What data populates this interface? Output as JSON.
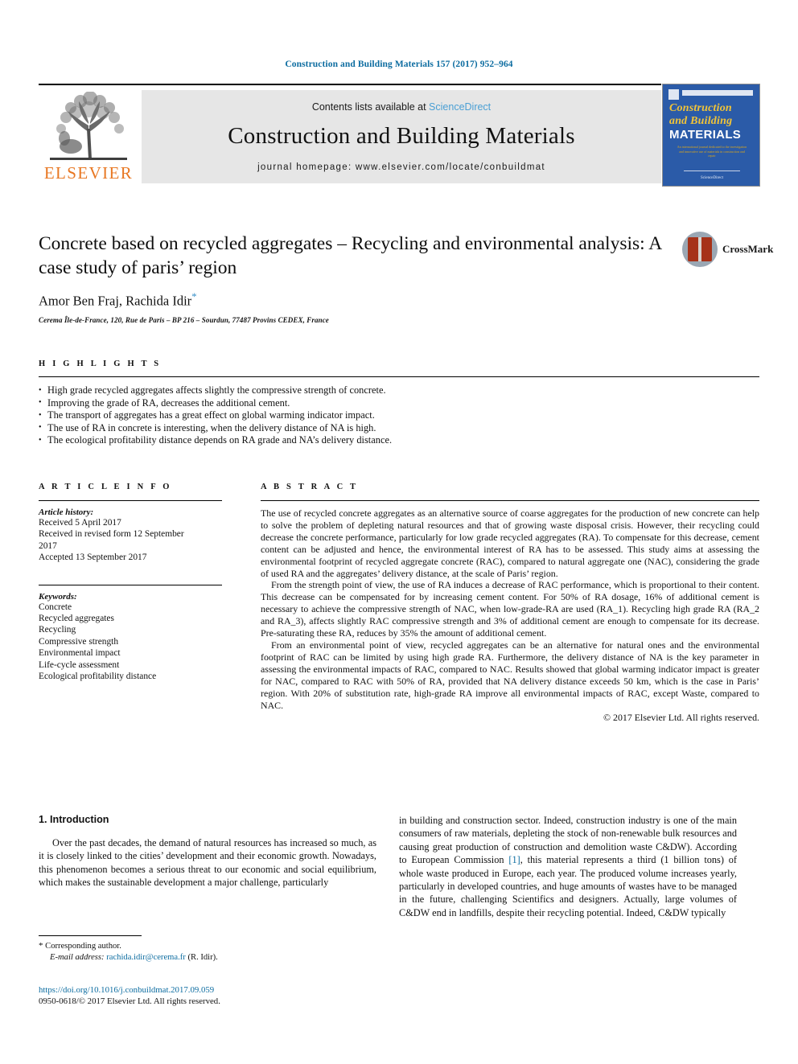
{
  "running_head": "Construction and Building Materials 157 (2017) 952–964",
  "masthead": {
    "contents_prefix": "Contents lists available at ",
    "sciencedirect": "ScienceDirect",
    "journal_title": "Construction and Building Materials",
    "homepage": "journal homepage: www.elsevier.com/locate/conbuildmat",
    "publisher_wordmark": "ELSEVIER"
  },
  "cover": {
    "line1": "Construction",
    "line2": "and Building",
    "line3": "MATERIALS",
    "blurb": "An international journal dedicated to the investigation and innovative use of materials in construction and repair",
    "foot": "ScienceDirect"
  },
  "crossmark": {
    "label": "CrossMark"
  },
  "article": {
    "title": "Concrete based on recycled aggregates – Recycling and environmental analysis: A case study of paris’ region",
    "authors": "Amor Ben Fraj, Rachida Idir",
    "corresponding_marker": "*",
    "affiliation": "Cerema Île-de-France, 120, Rue de Paris – BP 216 – Sourdun, 77487 Provins CEDEX, France"
  },
  "highlights": {
    "label": "H I G H L I G H T S",
    "items": [
      "High grade recycled aggregates affects slightly the compressive strength of concrete.",
      "Improving the grade of RA, decreases the additional cement.",
      "The transport of aggregates has a great effect on global warming indicator impact.",
      "The use of RA in concrete is interesting, when the delivery distance of NA is high.",
      "The ecological profitability distance depends on RA grade and NA’s delivery distance."
    ]
  },
  "article_info": {
    "label": "A R T I C L E   I N F O",
    "history_label": "Article history:",
    "history": [
      "Received 5 April 2017",
      "Received in revised form 12 September",
      "2017",
      "Accepted 13 September 2017"
    ],
    "keywords_label": "Keywords:",
    "keywords": [
      "Concrete",
      "Recycled aggregates",
      "Recycling",
      "Compressive strength",
      "Environmental impact",
      "Life-cycle assessment",
      "Ecological profitability distance"
    ]
  },
  "abstract": {
    "label": "A B S T R A C T",
    "paragraphs": [
      "The use of recycled concrete aggregates as an alternative source of coarse aggregates for the production of new concrete can help to solve the problem of depleting natural resources and that of growing waste disposal crisis. However, their recycling could decrease the concrete performance, particularly for low grade recycled aggregates (RA). To compensate for this decrease, cement content can be adjusted and hence, the environmental interest of RA has to be assessed. This study aims at assessing the environmental footprint of recycled aggregate concrete (RAC), compared to natural aggregate one (NAC), considering the grade of used RA and the aggregates’ delivery distance, at the scale of Paris’ region.",
      "From the strength point of view, the use of RA induces a decrease of RAC performance, which is proportional to their content. This decrease can be compensated for by increasing cement content. For 50% of RA dosage, 16% of additional cement is necessary to achieve the compressive strength of NAC, when low-grade-RA are used (RA_1). Recycling high grade RA (RA_2 and RA_3), affects slightly RAC compressive strength and 3% of additional cement are enough to compensate for its decrease. Pre-saturating these RA, reduces by 35% the amount of additional cement.",
      "From an environmental point of view, recycled aggregates can be an alternative for natural ones and the environmental footprint of RAC can be limited by using high grade RA. Furthermore, the delivery distance of NA is the key parameter in assessing the environmental impacts of RAC, compared to NAC. Results showed that global warming indicator impact is greater for NAC, compared to RAC with 50% of RA, provided that NA delivery distance exceeds 50 km, which is the case in Paris’ region. With 20% of substitution rate, high-grade RA improve all environmental impacts of RAC, except Waste, compared to NAC."
    ],
    "copyright": "© 2017 Elsevier Ltd. All rights reserved."
  },
  "introduction": {
    "heading": "1. Introduction",
    "left_paragraph": "Over the past decades, the demand of natural resources has increased so much, as it is closely linked to the cities’ development and their economic growth. Nowadays, this phenomenon becomes a serious threat to our economic and social equilibrium, which makes the sustainable development a major challenge, particularly",
    "right_part1": "in building and construction sector. Indeed, construction industry is one of the main consumers of raw materials, depleting the stock of non-renewable bulk resources and causing great production of construction and demolition waste C&DW). According to European Commission ",
    "right_reference": "[1]",
    "right_part2": ", this material represents a third (1 billion tons) of whole waste produced in Europe, each year. The produced volume increases yearly, particularly in developed countries, and huge amounts of wastes have to be managed in the future, challenging Scientifics and designers. Actually, large volumes of C&DW end in landfills, despite their recycling potential. Indeed, C&DW typically"
  },
  "footnote": {
    "star": "*",
    "corresponding": "Corresponding author.",
    "email_label": "E-mail address:",
    "email": "rachida.idir@cerema.fr",
    "email_suffix": "(R. Idir).",
    "doi": "https://doi.org/10.1016/j.conbuildmat.2017.09.059",
    "issn": "0950-0618/© 2017 Elsevier Ltd. All rights reserved."
  },
  "colors": {
    "link_blue": "#0c6ca0",
    "sciencedirect_blue": "#4a9fd4",
    "elsevier_orange": "#E87722",
    "cover_blue": "#2b5ba8",
    "cover_yellow": "#f2c437",
    "crossmark_red": "#a63219"
  }
}
